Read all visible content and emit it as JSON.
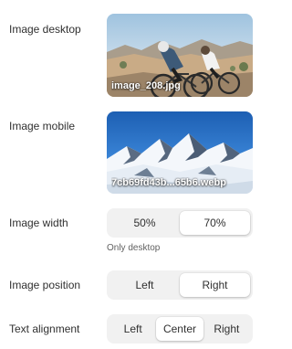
{
  "image_desktop": {
    "label": "Image desktop",
    "filename": "image_208.jpg"
  },
  "image_mobile": {
    "label": "Image mobile",
    "filename": "7cb69fd43b...65b6.webp"
  },
  "image_width": {
    "label": "Image width",
    "options": [
      "50%",
      "70%"
    ],
    "selected": "70%",
    "hint": "Only desktop"
  },
  "image_position": {
    "label": "Image position",
    "options": [
      "Left",
      "Right"
    ],
    "selected": "Right"
  },
  "text_alignment": {
    "label": "Text alignment",
    "options": [
      "Left",
      "Center",
      "Right"
    ],
    "selected": "Center"
  }
}
